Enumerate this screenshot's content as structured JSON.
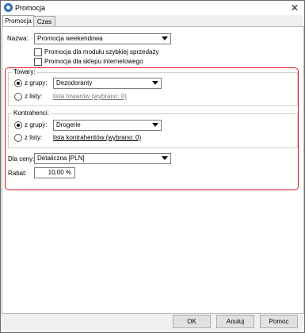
{
  "window": {
    "title": "Promocja",
    "close_glyph": "✕",
    "app_icon": "app-logo-icon"
  },
  "tabs": [
    {
      "label": "Promocja",
      "active": true
    },
    {
      "label": "Czas",
      "active": false
    }
  ],
  "form": {
    "nazwa_label": "Nazwa:",
    "nazwa_value": "Promocja weekendowa",
    "checkbox_quick_sale": {
      "label": "Promocja dla modułu szybkiej sprzedaży",
      "checked": false
    },
    "checkbox_online_shop": {
      "label": "Promocja dla sklepu internetowego",
      "checked": false
    }
  },
  "towary": {
    "title": "Towary:",
    "radio_group_label": "z grupy:",
    "radio_group_selected": true,
    "group_value": "Dezodoranty",
    "radio_list_label": "z listy:",
    "list_link": "lista towarów (wybrano: 0)"
  },
  "kontrahenci": {
    "title": "Kontrahenci:",
    "radio_group_label": "z grupy:",
    "radio_group_selected": true,
    "group_value": "Drogerie",
    "radio_list_label": "z listy:",
    "list_link": "lista kontrahentów (wybrano: 0)"
  },
  "price": {
    "label": "Dla ceny:",
    "value": "Detaliczna [PLN]"
  },
  "rabat": {
    "label": "Rabat:",
    "value": "10,00 %"
  },
  "buttons": {
    "ok": "OK",
    "cancel": "Anuluj",
    "help": "Pomoc"
  },
  "colors": {
    "highlight": "#e0141b",
    "panel": "#ffffff",
    "chrome": "#f0f0f0"
  }
}
